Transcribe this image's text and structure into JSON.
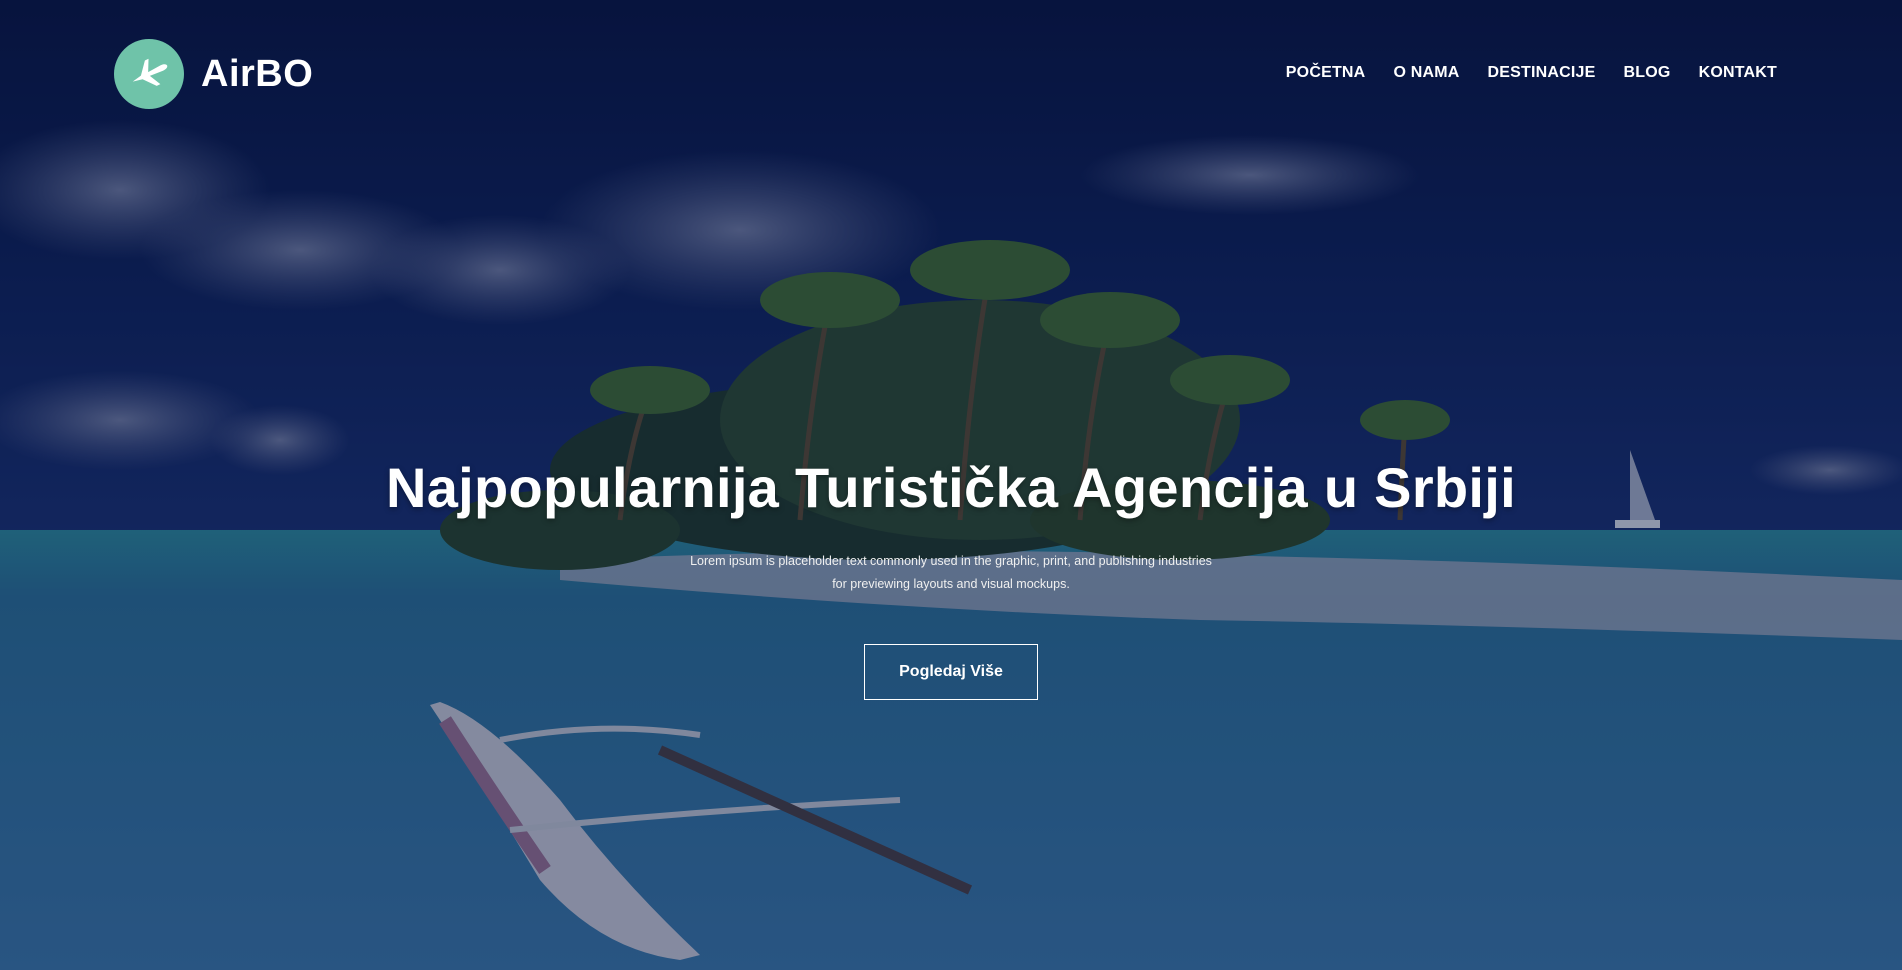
{
  "brand": {
    "name": "AirBO",
    "icon": "airplane-icon",
    "accent_color": "#6fc3a9"
  },
  "nav": {
    "items": [
      {
        "label": "POČETNA"
      },
      {
        "label": "O NAMA"
      },
      {
        "label": "DESTINACIJE"
      },
      {
        "label": "BLOG"
      },
      {
        "label": "KONTAKT"
      }
    ]
  },
  "hero": {
    "title": "Najpopularnija Turistička Agencija u Srbiji",
    "subtitle_line1": "Lorem ipsum is placeholder text commonly used in the graphic, print, and publishing industries",
    "subtitle_line2": "for previewing layouts and visual mockups.",
    "button_label": "Pogledaj Više"
  },
  "colors": {
    "overlay": "#0a143c",
    "sky": "#0b1a4a",
    "sea": "#2a5a8a",
    "button_border": "#ffffff"
  }
}
